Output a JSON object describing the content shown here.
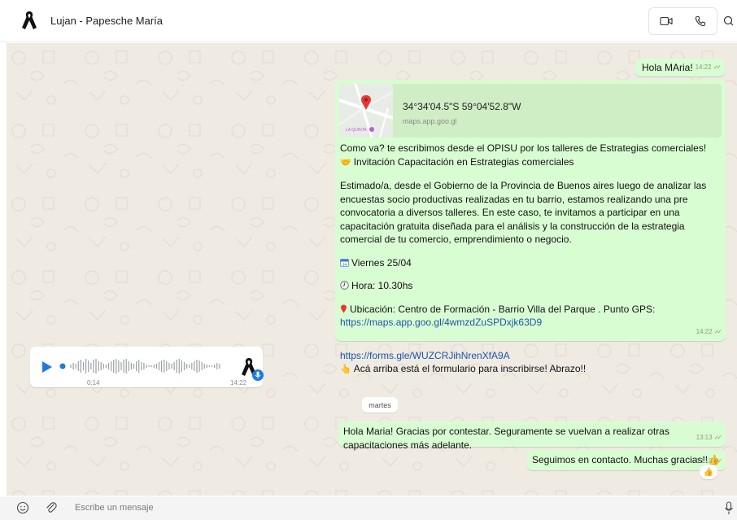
{
  "header": {
    "contact_name": "Lujan - Papesche María"
  },
  "messages": {
    "m1": {
      "text": "Hola MAria!",
      "time": "14:22"
    },
    "m2": {
      "link_title": "34°34'04.5\"S 59°04'52.8\"W",
      "link_domain": "maps.app.goo.gl",
      "map_label": "LA QUINTA",
      "line1": "Como va? te escribimos desde el OPISU por los talleres de Estrategias comerciales!",
      "line2": "Invitación Capacitación en Estrategias comerciales",
      "para": "Estimado/a, desde el Gobierno de la Provincia de Buenos aires luego de analizar las encuestas socio productivas realizadas en tu barrio, estamos realizando una pre convocatoria a diversos talleres. En este caso, te invitamos a participar en una capacitación gratuita diseñada para el análisis y la construcción de la estrategia comercial de tu comercio, emprendimiento o negocio.",
      "date_line": "Viernes 25/04",
      "calendar_day": "24",
      "time_line": "Hora: 10.30hs",
      "location_line": "Ubicación: Centro de Formación - Barrio Villa del Parque . Punto GPS:",
      "location_link": "https://maps.app.goo.gl/4wmzdZuSPDxjk63D9",
      "form_link": "https://forms.gle/WUZCRJihNrenXfA9A",
      "closing": "Acá arriba está el formulario para inscribirse! Abrazo!!",
      "time": "14:22"
    },
    "voice": {
      "duration": "0:14",
      "time": "14:22"
    },
    "day_separator": "martes",
    "m4": {
      "text": "Hola Maria! Gracias por contestar. Seguramente se vuelvan a realizar otras capacitaciones más adelante.",
      "time": "13:13"
    },
    "m5": {
      "text": "Seguimos en contacto. Muchas gracias!!",
      "time": "13:13"
    }
  },
  "composer": {
    "placeholder": "Escribe un mensaje"
  },
  "colors": {
    "outgoing_bubble": "#d9fdd3",
    "incoming_bubble": "#ffffff",
    "chat_background": "#efeae2",
    "accent_blue": "#1f7ae0",
    "link_blue": "#1a57a8"
  },
  "icons": {
    "header": [
      "black-ribbon-avatar-icon",
      "video-call-icon",
      "phone-call-icon",
      "search-icon"
    ],
    "composer": [
      "emoji-icon",
      "attach-icon",
      "microphone-icon"
    ]
  }
}
